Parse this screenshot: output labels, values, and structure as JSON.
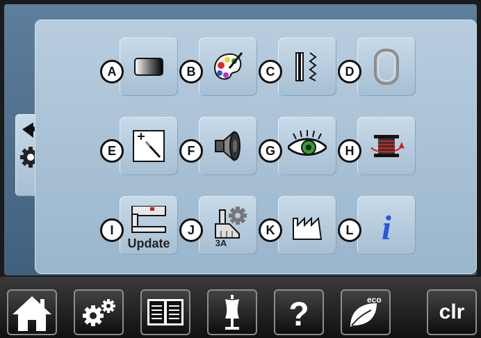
{
  "tiles": [
    {
      "letter": "A",
      "icon": "screen-contrast-icon"
    },
    {
      "letter": "B",
      "icon": "color-palette-icon"
    },
    {
      "letter": "C",
      "icon": "stitch-pattern-icon"
    },
    {
      "letter": "D",
      "icon": "embroidery-hoop-icon"
    },
    {
      "letter": "E",
      "icon": "touchscreen-calibration-icon"
    },
    {
      "letter": "F",
      "icon": "speaker-sound-icon"
    },
    {
      "letter": "G",
      "icon": "eye-monitoring-icon"
    },
    {
      "letter": "H",
      "icon": "bobbin-thread-icon"
    },
    {
      "letter": "I",
      "icon": "sewing-machine-update-icon",
      "text": "Update"
    },
    {
      "letter": "J",
      "icon": "presser-foot-settings-icon",
      "text": "3A"
    },
    {
      "letter": "K",
      "icon": "factory-settings-icon"
    },
    {
      "letter": "L",
      "icon": "info-icon"
    }
  ],
  "side": {
    "icon": "back-arrow-settings-icon"
  },
  "bottom_bar": [
    {
      "icon": "home-icon"
    },
    {
      "icon": "settings-gears-icon"
    },
    {
      "icon": "tutorial-book-icon"
    },
    {
      "icon": "dress-form-icon"
    },
    {
      "icon": "help-question-icon"
    },
    {
      "icon": "eco-mode-icon",
      "label": "eco"
    },
    {
      "icon": "clear-icon",
      "label": "clr"
    }
  ],
  "colors": {
    "panel": "#b1c8db",
    "frame": "#4d6d8b",
    "info_blue": "#2d55e0",
    "eye_green": "#2ea12e",
    "bobbin_red": "#d42020"
  }
}
